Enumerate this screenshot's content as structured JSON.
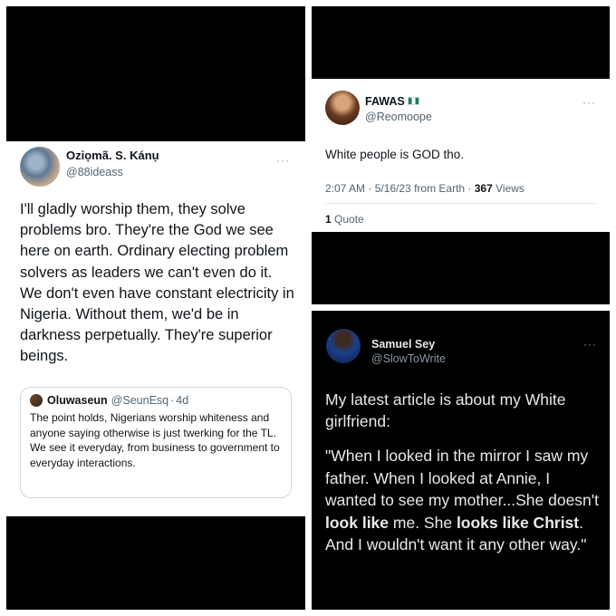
{
  "tweet_left": {
    "name": "Oziọmã. S. Kánụ",
    "handle": "@88ideass",
    "more": "···",
    "text": "I'll gladly worship them, they solve problems bro. They're the God we see here on earth. Ordinary electing problem solvers as leaders we can't even do it. We don't even have constant electricity in Nigeria. Without them, we'd be in darkness perpetually. They're superior beings.",
    "quoted": {
      "name": "Oluwaseun",
      "handle": "@SeunEsq",
      "separator": "·",
      "time": "4d",
      "text_1": "The point holds, Nigerians worship whiteness and anyone saying otherwise is just twerking for the TL.",
      "text_2": "We see it everyday, from business to government to everyday interactions."
    }
  },
  "tweet_top_right": {
    "name": "FAWAS",
    "handle": "@Reomoope",
    "more": "···",
    "text": "White people is GOD tho.",
    "time": "2:07 AM · 5/16/23 from Earth · ",
    "views_count": "367",
    "views_label": " Views",
    "quote_count": "1",
    "quote_label": " Quote"
  },
  "tweet_bottom_right": {
    "name": "Samuel Sey",
    "handle": "@SlowToWrite",
    "more": "···",
    "text_intro": "My latest article is about my White girlfriend:",
    "quote_part1": "\"When I looked in the mirror I saw my father. When I looked at Annie, I wanted to see my mother...She doesn't ",
    "quote_bold1": "look like",
    "quote_part2": " me. She ",
    "quote_bold2": "looks like Christ",
    "quote_part3": ". And I wouldn't want it any other way.\""
  }
}
